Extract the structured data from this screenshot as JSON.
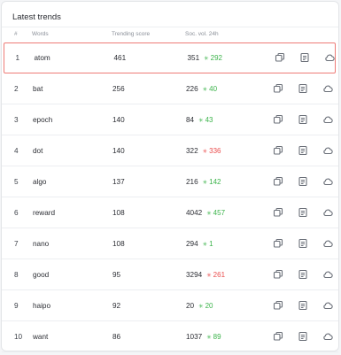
{
  "panel": {
    "title": "Latest trends"
  },
  "table": {
    "headers": {
      "rank": "#",
      "word": "Words",
      "score": "Trending score",
      "volume": "Soc. vol. 24h"
    },
    "rows": [
      {
        "rank": "1",
        "word": "atom",
        "score": "461",
        "volume": "351",
        "change": "292",
        "direction": "up"
      },
      {
        "rank": "2",
        "word": "bat",
        "score": "256",
        "volume": "226",
        "change": "40",
        "direction": "up"
      },
      {
        "rank": "3",
        "word": "epoch",
        "score": "140",
        "volume": "84",
        "change": "43",
        "direction": "up"
      },
      {
        "rank": "4",
        "word": "dot",
        "score": "140",
        "volume": "322",
        "change": "336",
        "direction": "down"
      },
      {
        "rank": "5",
        "word": "algo",
        "score": "137",
        "volume": "216",
        "change": "142",
        "direction": "up"
      },
      {
        "rank": "6",
        "word": "reward",
        "score": "108",
        "volume": "4042",
        "change": "457",
        "direction": "up"
      },
      {
        "rank": "7",
        "word": "nano",
        "score": "108",
        "volume": "294",
        "change": "1",
        "direction": "up"
      },
      {
        "rank": "8",
        "word": "good",
        "score": "95",
        "volume": "3294",
        "change": "261",
        "direction": "down"
      },
      {
        "rank": "9",
        "word": "haipo",
        "score": "92",
        "volume": "20",
        "change": "20",
        "direction": "up"
      },
      {
        "rank": "10",
        "word": "want",
        "score": "86",
        "volume": "1037",
        "change": "89",
        "direction": "up"
      }
    ],
    "highlighted_row": 0,
    "row_icons": [
      "copy-icon",
      "document-icon",
      "cloud-icon"
    ]
  },
  "colors": {
    "up": "#3bb34a",
    "down": "#ea4d4d",
    "highlight_border": "#ee7b76"
  }
}
